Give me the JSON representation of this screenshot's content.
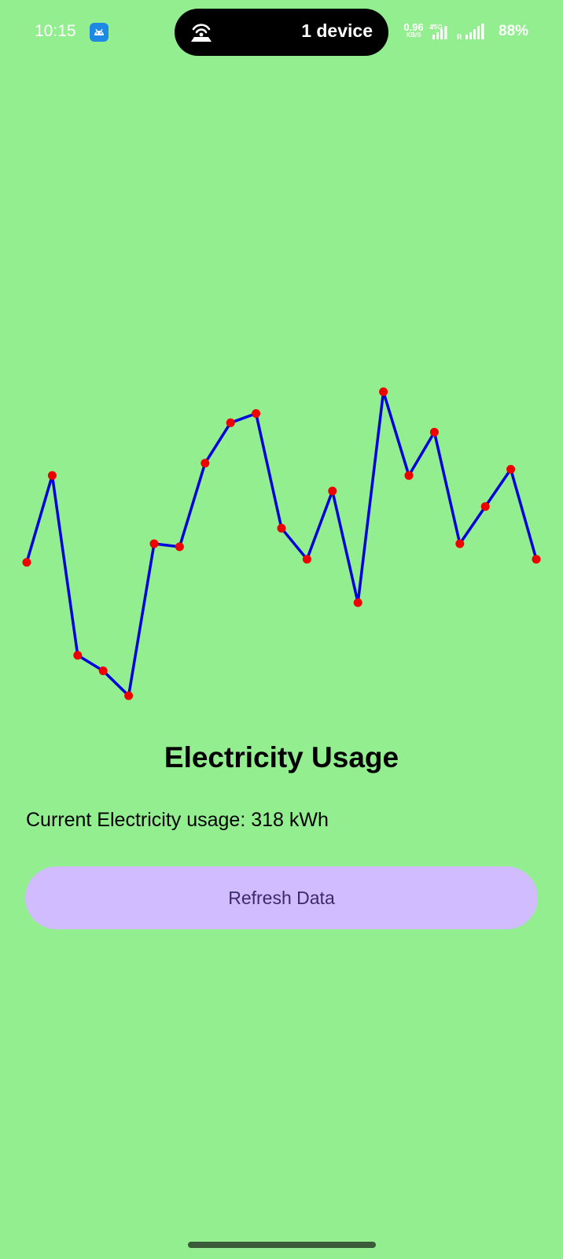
{
  "status_bar": {
    "time": "10:15",
    "pill_text": "1 device",
    "net_speed_value": "0.96",
    "net_speed_unit": "KB/S",
    "battery": "88%",
    "icons": [
      "android-notification-icon",
      "hotspot-icon",
      "signal-5g-icon",
      "roaming-signal-icon"
    ]
  },
  "chart_data": {
    "type": "line",
    "x": [
      0,
      1,
      2,
      3,
      4,
      5,
      6,
      7,
      8,
      9,
      10,
      11,
      12,
      13,
      14,
      15,
      16,
      17,
      18,
      19,
      20
    ],
    "series": [
      {
        "values": [
          0.44,
          0.72,
          0.14,
          0.09,
          0.01,
          0.5,
          0.49,
          0.76,
          0.89,
          0.92,
          0.55,
          0.45,
          0.67,
          0.31,
          0.99,
          0.72,
          0.86,
          0.5,
          0.62,
          0.74,
          0.45
        ]
      }
    ],
    "ylim": [
      0,
      1
    ],
    "grid": false,
    "line_color": "#0000dd",
    "marker_color": "#ee0000"
  },
  "main": {
    "title": "Electricity Usage",
    "usage_text": "Current Electricity usage: 318 kWh",
    "refresh_label": "Refresh Data"
  },
  "colors": {
    "background": "#92ee8e",
    "button": "#d0bcff",
    "button_text": "#3b2a6e"
  }
}
